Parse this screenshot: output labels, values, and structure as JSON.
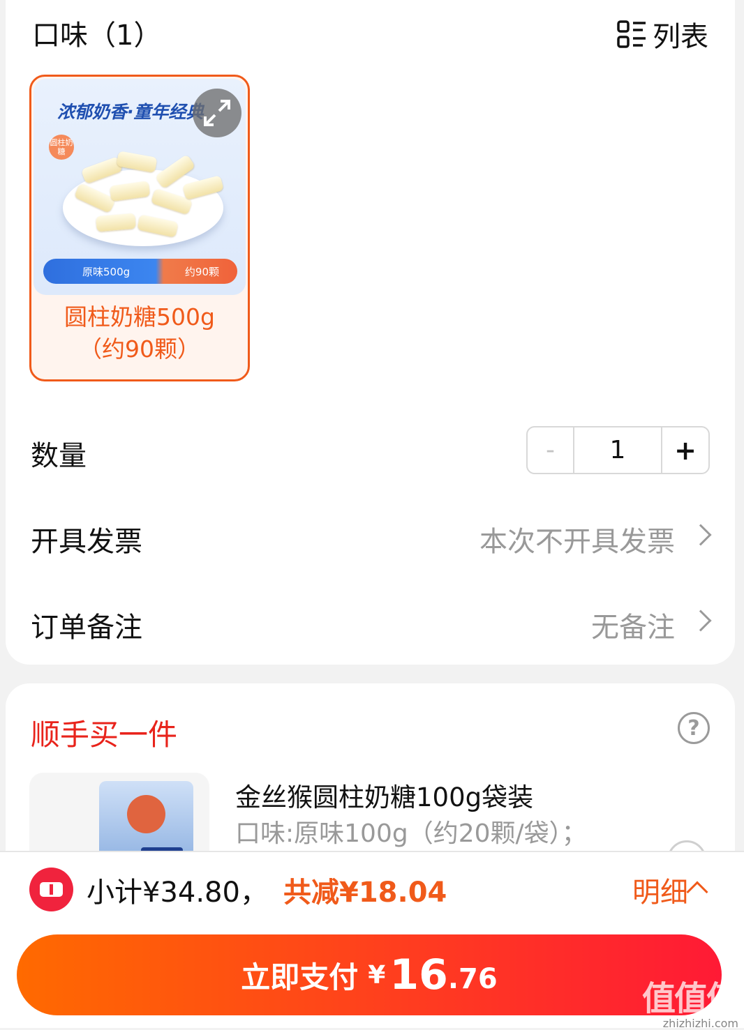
{
  "flavor_section": {
    "title": "口味（1）",
    "list_toggle_label": "列表",
    "sku": {
      "image_slogan": "浓郁奶香·童年经典",
      "image_badge": "圆柱奶糖",
      "image_pill_left": "原味500g",
      "image_pill_right": "约90颗",
      "name_line1": "圆柱奶糖500g",
      "name_line2": "（约90颗）"
    }
  },
  "quantity": {
    "label": "数量",
    "minus": "-",
    "value": "1",
    "plus": "+"
  },
  "invoice": {
    "label": "开具发票",
    "value": "本次不开具发票"
  },
  "remark": {
    "label": "订单备注",
    "value": "无备注"
  },
  "addon": {
    "title": "顺手买一件",
    "help": "?",
    "product": {
      "name": "金丝猴圆柱奶糖100g袋装",
      "spec": "口味:原味100g（约20颗/袋）；"
    }
  },
  "footer": {
    "subtotal": "小计¥34.80，",
    "discount": "共减¥18.04",
    "detail_label": "明细",
    "pay_label": "立即支付",
    "pay_currency": "¥",
    "pay_integer": "16",
    "pay_decimal": ".76"
  },
  "watermark": {
    "main": "值值值",
    "sub": "zhizhizhi.com"
  },
  "colors": {
    "accent": "#f05a1a",
    "red": "#e8231b",
    "pay_start": "#ff6a00",
    "pay_end": "#ff1a35"
  },
  "icons": [
    "list-icon",
    "expand-icon",
    "chevron-right-icon",
    "help-icon",
    "coupon-icon",
    "chevron-up-icon"
  ]
}
